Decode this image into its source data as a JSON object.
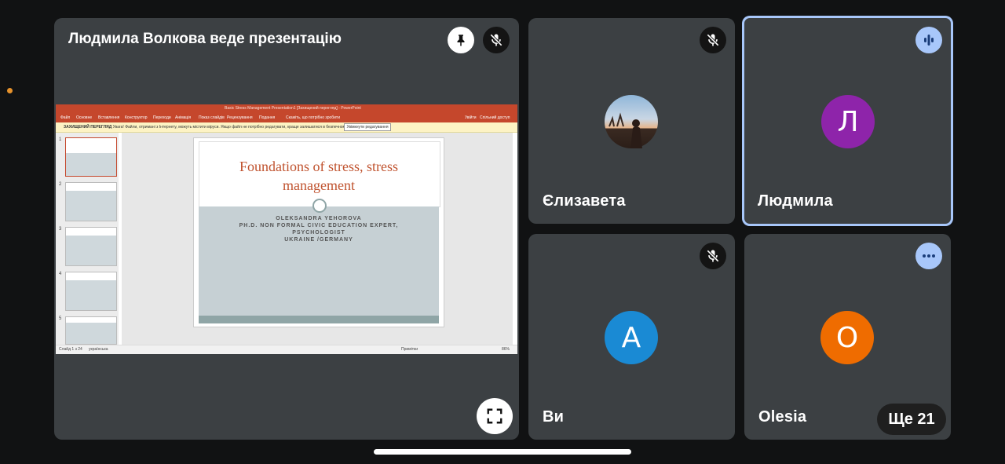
{
  "presenter_tile": {
    "title": "Людмила Волкова веде презентацію",
    "shared_screen": {
      "window_title": "Basic Stress Management Presentation1 [Захищений перегляд] - PowerPoint",
      "menu": [
        "Файл",
        "Основне",
        "Вставлення",
        "Конструктор",
        "Переходи",
        "Анімація",
        "Показ слайдів",
        "Рецензування",
        "Подання"
      ],
      "search_hint": "Скажіть, що потрібно зробити",
      "signin": "Увійти",
      "share": "Спільний доступ",
      "warning_label": "ЗАХИЩЕНИЙ ПЕРЕГЛЯД",
      "warning_text": "Увага! Файли, отримані з Інтернету, можуть містити віруси. Якщо файл не потрібно редагувати, краще залишатися в безпечному поданні.",
      "warning_button": "Увімкнути редагування",
      "thumb_numbers": [
        "1",
        "2",
        "3",
        "4",
        "5"
      ],
      "slide_title": "Foundations of stress, stress management",
      "slide_subtitle_lines": [
        "OLEKSANDRA YEHOROVA",
        "PH.D. NON FORMAL CIVIC  EDUCATION EXPERT,",
        "PSYCHOLOGIST",
        "UKRAINE /GERMANY"
      ],
      "status_left": "Слайд 1 з 24",
      "status_lang": "українська",
      "status_notes": "Примітки",
      "zoom": "86%"
    }
  },
  "participants": [
    {
      "name": "Єлизавета",
      "initial": "",
      "muted": true
    },
    {
      "name": "Людмила",
      "initial": "Л",
      "color": "#8e24aa",
      "speaking": true
    },
    {
      "name": "Ви",
      "initial": "A",
      "color": "#1a8ad4",
      "muted": true
    },
    {
      "name": "Olesia",
      "initial": "O",
      "color": "#ef6c00"
    }
  ],
  "more_label": "Ще 21",
  "colors": {
    "tile_bg": "#3c4043",
    "active_border": "#a8c7fa",
    "ppt_red": "#c5472c"
  }
}
